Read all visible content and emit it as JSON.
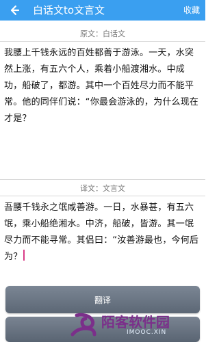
{
  "topbar": {
    "back_icon": "back-arrow-icon",
    "title": "白话文to文言文",
    "action_label": "收藏",
    "bg_color": "#3a9ff0"
  },
  "source": {
    "section_label": "原文：白话文",
    "text": "我腰上千钱永远的百姓都善于游泳。一天，水突然上涨，有五六个人，乘着小船渡湘水。中成功，船破了，都游。其中一个百姓尽力而不能平常。他的同伴们说：“你最会游泳的，为什么现在才是？"
  },
  "target": {
    "section_label": "译文：文言文",
    "text": "吾腰千钱永之氓咸善游。一日，水暴甚，有五六氓，乘小船绝湘水。中济，船破，皆游。其一氓尽力而不能寻常。其侣曰：“汝善游最也，今何后为？"
  },
  "buttons": {
    "translate_label": "翻译",
    "second_label": ""
  },
  "watermark": {
    "text": "陌客软件园",
    "sub": "IMOOC.XIN"
  }
}
